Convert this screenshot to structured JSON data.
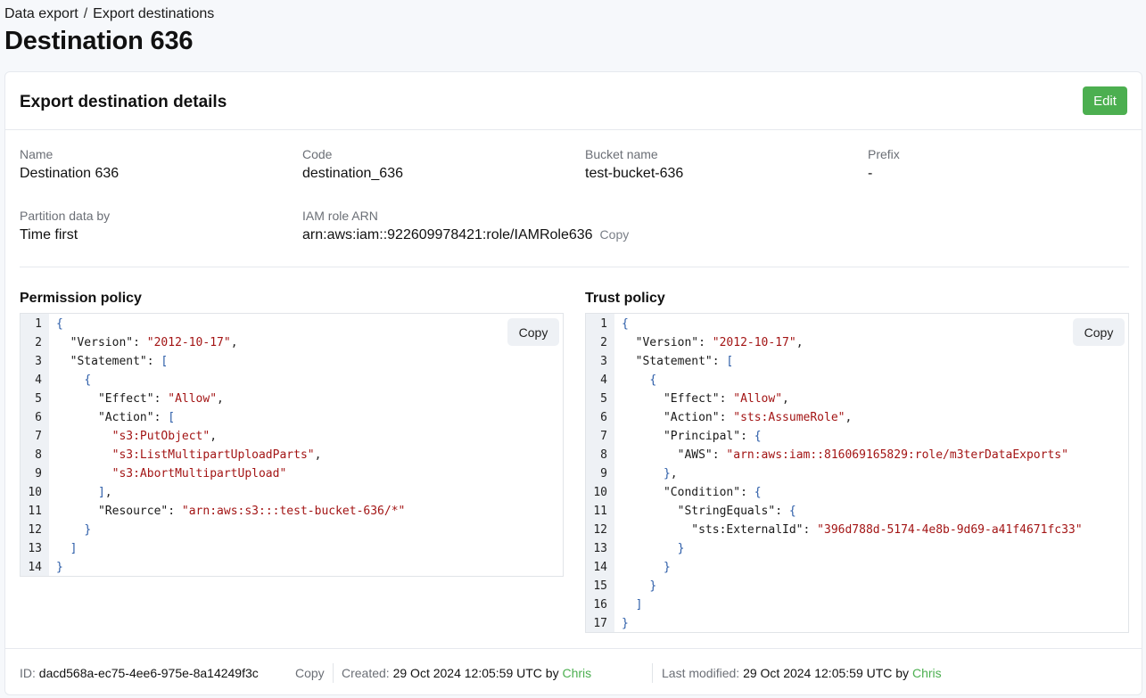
{
  "breadcrumb": {
    "parent": "Data export",
    "separator": "/",
    "current": "Export destinations"
  },
  "page_title": "Destination 636",
  "card": {
    "title": "Export destination details",
    "edit_label": "Edit"
  },
  "fields": {
    "name": {
      "label": "Name",
      "value": "Destination 636"
    },
    "code": {
      "label": "Code",
      "value": "destination_636"
    },
    "bucket": {
      "label": "Bucket name",
      "value": "test-bucket-636"
    },
    "prefix": {
      "label": "Prefix",
      "value": "-"
    },
    "partition": {
      "label": "Partition data by",
      "value": "Time first"
    },
    "iam": {
      "label": "IAM role ARN",
      "value": "arn:aws:iam::922609978421:role/IAMRole636",
      "copy_label": "Copy"
    }
  },
  "permission_policy": {
    "title": "Permission policy",
    "copy_label": "Copy",
    "lines": [
      [
        [
          "p",
          "{"
        ]
      ],
      [
        [
          "c",
          "  "
        ],
        [
          "k",
          "\"Version\""
        ],
        [
          "c",
          ": "
        ],
        [
          "s",
          "\"2012-10-17\""
        ],
        [
          "c",
          ","
        ]
      ],
      [
        [
          "c",
          "  "
        ],
        [
          "k",
          "\"Statement\""
        ],
        [
          "c",
          ": "
        ],
        [
          "p",
          "["
        ]
      ],
      [
        [
          "c",
          "    "
        ],
        [
          "p",
          "{"
        ]
      ],
      [
        [
          "c",
          "      "
        ],
        [
          "k",
          "\"Effect\""
        ],
        [
          "c",
          ": "
        ],
        [
          "s",
          "\"Allow\""
        ],
        [
          "c",
          ","
        ]
      ],
      [
        [
          "c",
          "      "
        ],
        [
          "k",
          "\"Action\""
        ],
        [
          "c",
          ": "
        ],
        [
          "p",
          "["
        ]
      ],
      [
        [
          "c",
          "        "
        ],
        [
          "s",
          "\"s3:PutObject\""
        ],
        [
          "c",
          ","
        ]
      ],
      [
        [
          "c",
          "        "
        ],
        [
          "s",
          "\"s3:ListMultipartUploadParts\""
        ],
        [
          "c",
          ","
        ]
      ],
      [
        [
          "c",
          "        "
        ],
        [
          "s",
          "\"s3:AbortMultipartUpload\""
        ]
      ],
      [
        [
          "c",
          "      "
        ],
        [
          "p",
          "]"
        ],
        [
          "c",
          ","
        ]
      ],
      [
        [
          "c",
          "      "
        ],
        [
          "k",
          "\"Resource\""
        ],
        [
          "c",
          ": "
        ],
        [
          "s",
          "\"arn:aws:s3:::test-bucket-636/*\""
        ]
      ],
      [
        [
          "c",
          "    "
        ],
        [
          "p",
          "}"
        ]
      ],
      [
        [
          "c",
          "  "
        ],
        [
          "p",
          "]"
        ]
      ],
      [
        [
          "p",
          "}"
        ]
      ]
    ]
  },
  "trust_policy": {
    "title": "Trust policy",
    "copy_label": "Copy",
    "lines": [
      [
        [
          "p",
          "{"
        ]
      ],
      [
        [
          "c",
          "  "
        ],
        [
          "k",
          "\"Version\""
        ],
        [
          "c",
          ": "
        ],
        [
          "s",
          "\"2012-10-17\""
        ],
        [
          "c",
          ","
        ]
      ],
      [
        [
          "c",
          "  "
        ],
        [
          "k",
          "\"Statement\""
        ],
        [
          "c",
          ": "
        ],
        [
          "p",
          "["
        ]
      ],
      [
        [
          "c",
          "    "
        ],
        [
          "p",
          "{"
        ]
      ],
      [
        [
          "c",
          "      "
        ],
        [
          "k",
          "\"Effect\""
        ],
        [
          "c",
          ": "
        ],
        [
          "s",
          "\"Allow\""
        ],
        [
          "c",
          ","
        ]
      ],
      [
        [
          "c",
          "      "
        ],
        [
          "k",
          "\"Action\""
        ],
        [
          "c",
          ": "
        ],
        [
          "s",
          "\"sts:AssumeRole\""
        ],
        [
          "c",
          ","
        ]
      ],
      [
        [
          "c",
          "      "
        ],
        [
          "k",
          "\"Principal\""
        ],
        [
          "c",
          ": "
        ],
        [
          "p",
          "{"
        ]
      ],
      [
        [
          "c",
          "        "
        ],
        [
          "k",
          "\"AWS\""
        ],
        [
          "c",
          ": "
        ],
        [
          "s",
          "\"arn:aws:iam::816069165829:role/m3terDataExports\""
        ]
      ],
      [
        [
          "c",
          "      "
        ],
        [
          "p",
          "}"
        ],
        [
          "c",
          ","
        ]
      ],
      [
        [
          "c",
          "      "
        ],
        [
          "k",
          "\"Condition\""
        ],
        [
          "c",
          ": "
        ],
        [
          "p",
          "{"
        ]
      ],
      [
        [
          "c",
          "        "
        ],
        [
          "k",
          "\"StringEquals\""
        ],
        [
          "c",
          ": "
        ],
        [
          "p",
          "{"
        ]
      ],
      [
        [
          "c",
          "          "
        ],
        [
          "k",
          "\"sts:ExternalId\""
        ],
        [
          "c",
          ": "
        ],
        [
          "s",
          "\"396d788d-5174-4e8b-9d69-a41f4671fc33\""
        ]
      ],
      [
        [
          "c",
          "        "
        ],
        [
          "p",
          "}"
        ]
      ],
      [
        [
          "c",
          "      "
        ],
        [
          "p",
          "}"
        ]
      ],
      [
        [
          "c",
          "    "
        ],
        [
          "p",
          "}"
        ]
      ],
      [
        [
          "c",
          "  "
        ],
        [
          "p",
          "]"
        ]
      ],
      [
        [
          "p",
          "}"
        ]
      ]
    ]
  },
  "footer": {
    "id_label": "ID:",
    "id_value": "dacd568a-ec75-4ee6-975e-8a14249f3c",
    "copy_label": "Copy",
    "created_label": "Created:",
    "created_value": "29 Oct 2024 12:05:59 UTC by",
    "created_by": "Chris",
    "modified_label": "Last modified:",
    "modified_value": "29 Oct 2024 12:05:59 UTC by",
    "modified_by": "Chris"
  },
  "colors": {
    "accent": "#4caf50",
    "string": "#a31515",
    "punct": "#2b5ca8"
  }
}
